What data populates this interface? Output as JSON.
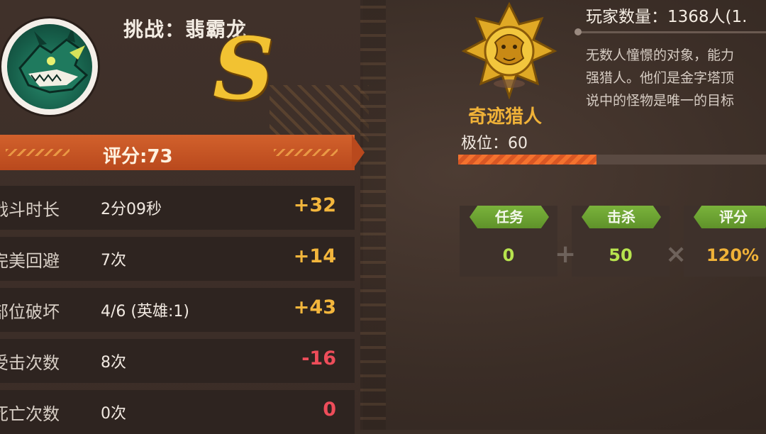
{
  "challenge": {
    "title": "挑战：翡霸龙",
    "rank_letter": "S"
  },
  "score": {
    "label": "评分:73"
  },
  "stats": [
    {
      "label": "战斗时长",
      "value": "2分09秒",
      "delta": "+32"
    },
    {
      "label": "完美回避",
      "value": "7次",
      "delta": "+14"
    },
    {
      "label": "部位破坏",
      "value": "4/6 (英雄:1)",
      "delta": "+43"
    },
    {
      "label": "受击次数",
      "value": "8次",
      "delta": "-16"
    },
    {
      "label": "死亡次数",
      "value": "0次",
      "delta": "0"
    }
  ],
  "hunter": {
    "title": "奇迹猎人",
    "rank_label": "极位：60",
    "rank_progress": 0.45
  },
  "players": {
    "count_text": "玩家数量：1368人(1."
  },
  "description": {
    "lines": [
      "无数人憧憬的对象，能力",
      "强猎人。他们是金字塔顶",
      "说中的怪物是唯一的目标"
    ]
  },
  "formula": {
    "items": [
      {
        "label": "任务",
        "value": "0",
        "color": "#b7e34e"
      },
      {
        "label": "击杀",
        "value": "50",
        "color": "#b7e34e"
      },
      {
        "label": "评分",
        "value": "120%",
        "color": "#f0b238"
      }
    ],
    "operators": [
      "+",
      "×"
    ]
  },
  "colors": {
    "positive": "#f3b63c",
    "negative": "#ee4d5a",
    "accent": "#d2612c",
    "tag_green": "#6fa633"
  },
  "icons": {
    "avatar": "dragon-portrait-icon",
    "medal": "gold-lion-medal-icon"
  }
}
